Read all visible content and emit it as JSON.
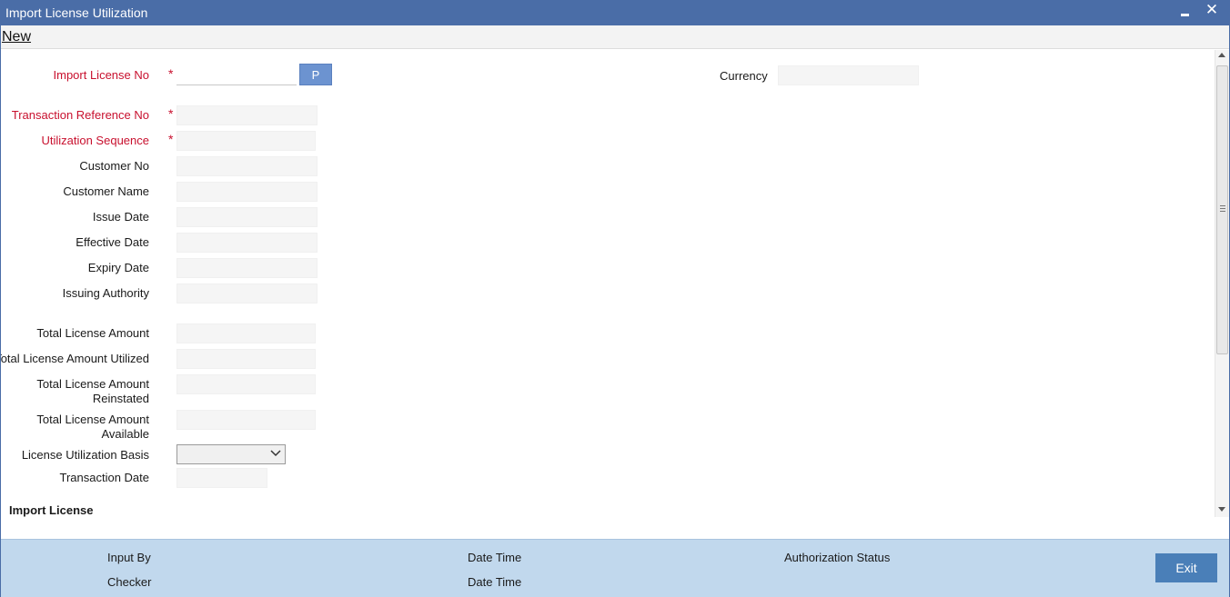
{
  "window": {
    "title": "Import License Utilization",
    "close_glyph": "✕"
  },
  "menu": {
    "new_label": "New"
  },
  "form": {
    "import_license_no": {
      "label": "Import License No",
      "value": "",
      "required": true
    },
    "pickup_button_label": "P",
    "currency": {
      "label": "Currency",
      "value": ""
    },
    "transaction_reference_no": {
      "label": "Transaction Reference No",
      "value": "",
      "required": true
    },
    "utilization_sequence": {
      "label": "Utilization Sequence",
      "value": "",
      "required": true
    },
    "customer_no": {
      "label": "Customer No",
      "value": ""
    },
    "customer_name": {
      "label": "Customer Name",
      "value": ""
    },
    "issue_date": {
      "label": "Issue Date",
      "value": ""
    },
    "effective_date": {
      "label": "Effective Date",
      "value": ""
    },
    "expiry_date": {
      "label": "Expiry Date",
      "value": ""
    },
    "issuing_authority": {
      "label": "Issuing Authority",
      "value": ""
    },
    "total_license_amount": {
      "label": "Total License Amount",
      "value": ""
    },
    "total_license_amount_utilized": {
      "label": "Total License Amount Utilized",
      "value": ""
    },
    "total_license_amount_reinstated": {
      "label_line1": "Total License Amount",
      "label_line2": "Reinstated",
      "value": ""
    },
    "total_license_amount_available": {
      "label_line1": "Total License Amount",
      "label_line2": "Available",
      "value": ""
    },
    "license_utilization_basis": {
      "label": "License Utilization Basis",
      "selected": ""
    },
    "transaction_date": {
      "label": "Transaction Date",
      "value": ""
    },
    "required_marker": "*"
  },
  "section": {
    "import_license_title": "Import License"
  },
  "footer": {
    "input_by": "Input By",
    "date_time_1": "Date Time",
    "authorization_status": "Authorization Status",
    "checker": "Checker",
    "date_time_2": "Date Time",
    "exit_label": "Exit"
  },
  "colors": {
    "titlebar": "#4a6da7",
    "required_label": "#c8102e",
    "footer_bg": "#c1d8ed",
    "exit_button": "#4a7fb8"
  }
}
